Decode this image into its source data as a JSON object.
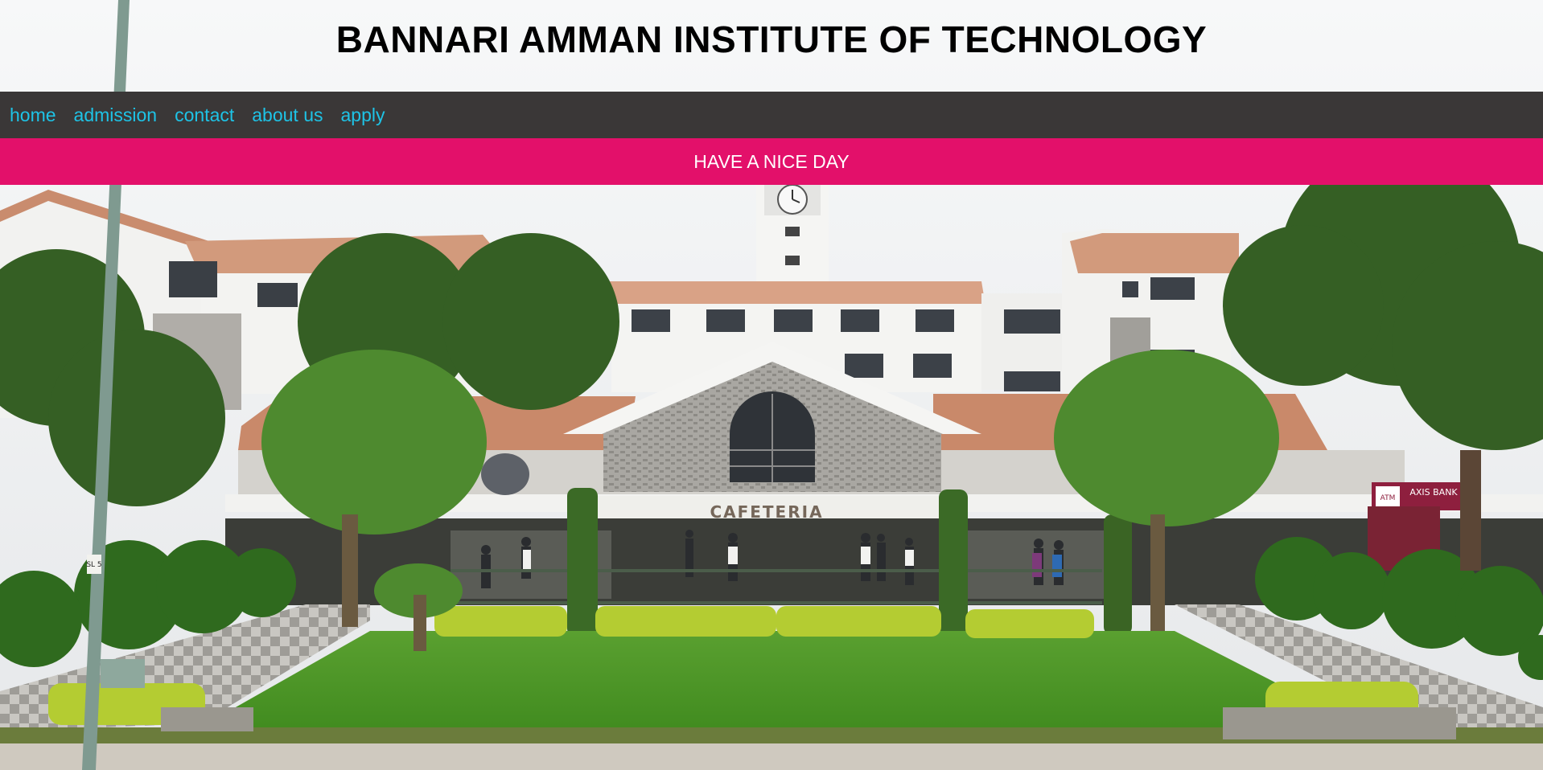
{
  "header": {
    "title": "BANNARI AMMAN INSTITUTE OF TECHNOLOGY"
  },
  "nav": {
    "items": [
      {
        "label": "home"
      },
      {
        "label": "admission"
      },
      {
        "label": "contact"
      },
      {
        "label": "about us"
      },
      {
        "label": "apply"
      }
    ]
  },
  "banner": {
    "text": "HAVE A NICE DAY"
  },
  "hero": {
    "building_sign": "CAFETERIA",
    "atm_sign": "AXIS BANK",
    "atm_label": "ATM",
    "pole_tag": "SL 5"
  },
  "colors": {
    "nav_background": "#3a3737",
    "nav_link": "#1ec3e6",
    "banner_background": "#e3106a",
    "banner_text": "#ffffff"
  }
}
